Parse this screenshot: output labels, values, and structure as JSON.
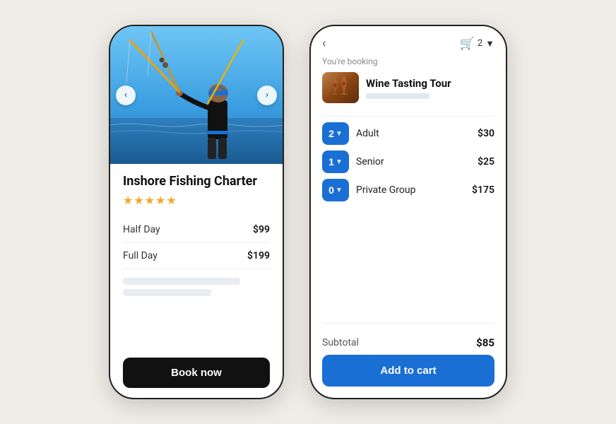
{
  "left_phone": {
    "product_title": "Inshore Fishing Charter",
    "stars": "★★★★★",
    "options": [
      {
        "label": "Half Day",
        "price": "$99"
      },
      {
        "label": "Full Day",
        "price": "$199"
      }
    ],
    "book_button": "Book now",
    "nav_left": "‹",
    "nav_right": "›"
  },
  "right_phone": {
    "back": "‹",
    "cart_count": "2",
    "cart_label": "▼",
    "cart_icon": "🛒",
    "booking_label": "You're booking",
    "booking_title": "Wine Tasting Tour",
    "tickets": [
      {
        "qty": "2",
        "name": "Adult",
        "price": "$30"
      },
      {
        "qty": "1",
        "name": "Senior",
        "price": "$25"
      },
      {
        "qty": "0",
        "name": "Private Group",
        "price": "$175"
      }
    ],
    "subtotal_label": "Subtotal",
    "subtotal_value": "$85",
    "add_cart_button": "Add to cart"
  }
}
